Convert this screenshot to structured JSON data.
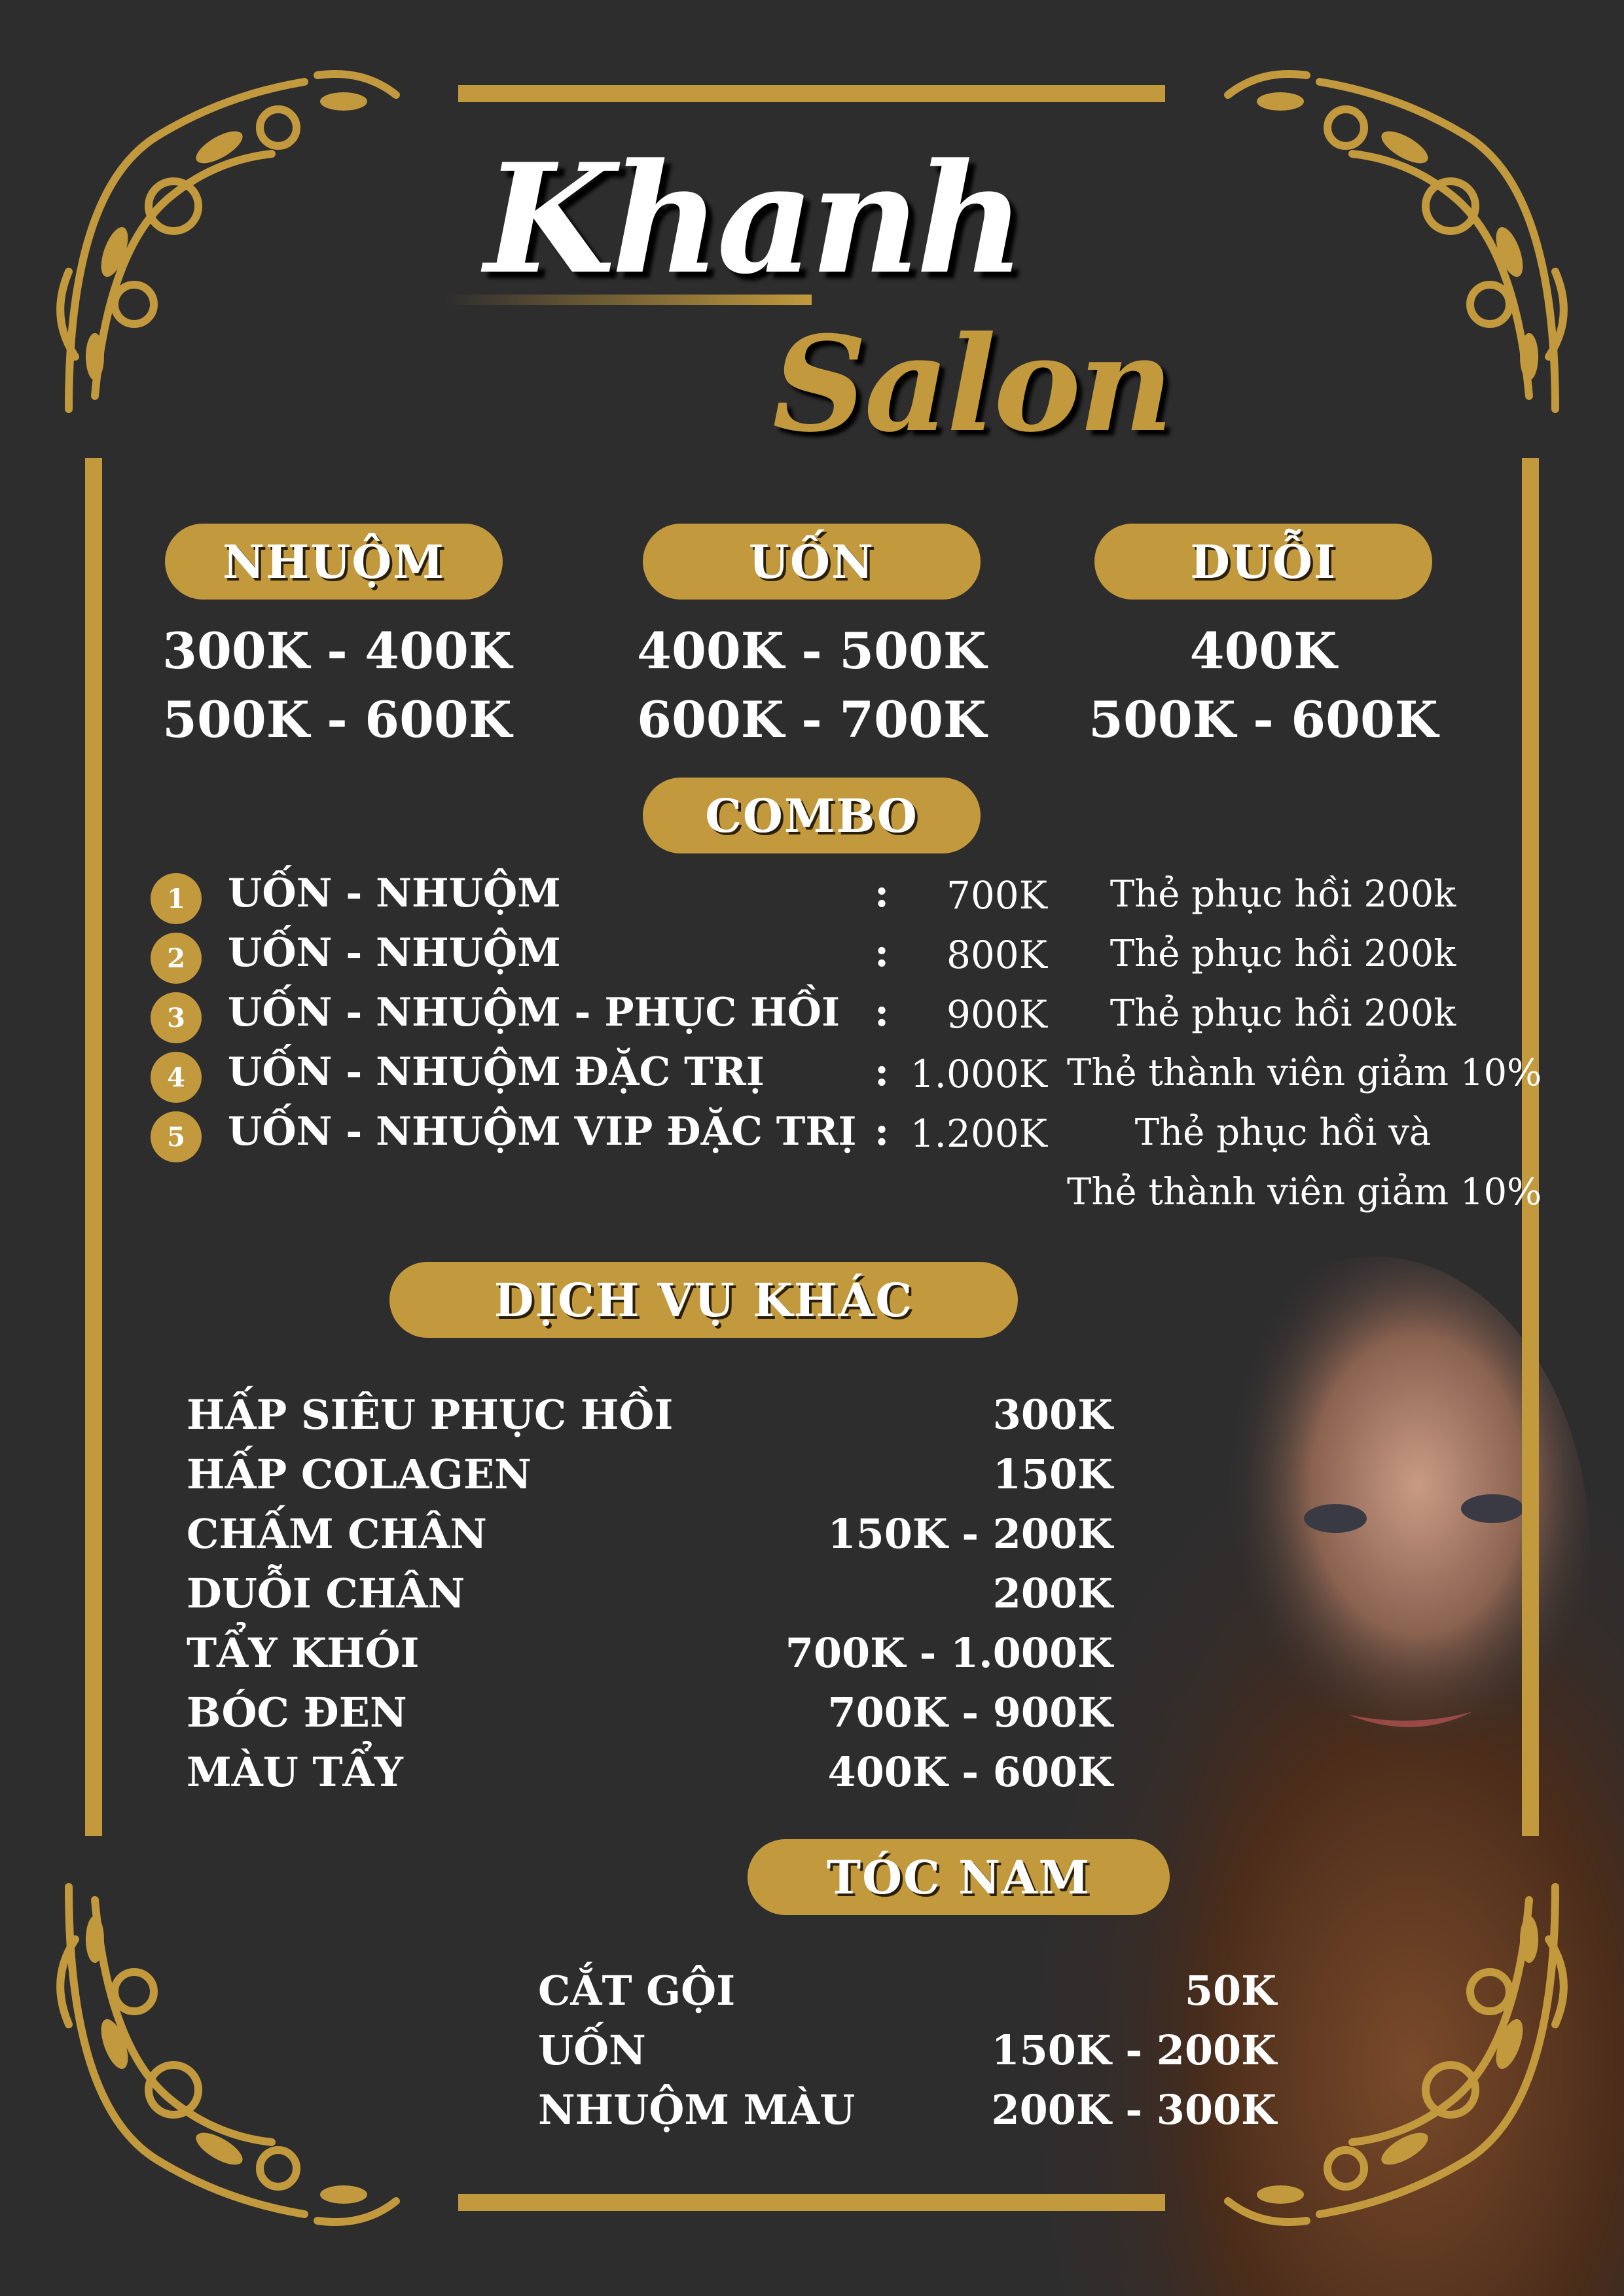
{
  "brand": {
    "line1": "Khanh",
    "line2": "Salon"
  },
  "prices": [
    {
      "title": "NHUỘM",
      "values": [
        "300K - 400K",
        "500K - 600K"
      ]
    },
    {
      "title": "UỐN",
      "values": [
        "400K - 500K",
        "600K - 700K"
      ]
    },
    {
      "title": "DUỖI",
      "values": [
        "400K",
        "500K - 600K"
      ]
    }
  ],
  "combo": {
    "title": "COMBO",
    "items": [
      {
        "num": "1",
        "name": "UỐN - NHUỘM",
        "colon": ":",
        "price": "700K",
        "note": "Thẻ phục hồi 200k"
      },
      {
        "num": "2",
        "name": "UỐN - NHUỘM",
        "colon": ":",
        "price": "800K",
        "note": "Thẻ phục hồi 200k"
      },
      {
        "num": "3",
        "name": "UỐN - NHUỘM - PHỤC HỒI",
        "colon": ":",
        "price": "900K",
        "note": "Thẻ phục hồi 200k"
      },
      {
        "num": "4",
        "name": "UỐN - NHUỘM ĐẶC TRỊ",
        "colon": ":",
        "price": "1.000K",
        "note": "Thẻ thành viên giảm 10%"
      },
      {
        "num": "5",
        "name": "UỐN - NHUỘM VIP ĐẶC TRỊ",
        "colon": ":",
        "price": "1.200K",
        "note": "Thẻ phục hồi và",
        "note2": "Thẻ thành viên giảm 10%"
      }
    ]
  },
  "other": {
    "title": "DỊCH VỤ KHÁC",
    "items": [
      {
        "name": "HẤP SIÊU PHỤC HỒI",
        "price": "300K"
      },
      {
        "name": "HẤP COLAGEN",
        "price": "150K"
      },
      {
        "name": "CHẤM CHÂN",
        "price": "150K - 200K"
      },
      {
        "name": "DUỖI CHÂN",
        "price": "200K"
      },
      {
        "name": "TẨY KHÓI",
        "price": "700K - 1.000K"
      },
      {
        "name": "BÓC ĐEN",
        "price": "700K - 900K"
      },
      {
        "name": "MÀU TẨY",
        "price": "400K - 600K"
      }
    ]
  },
  "men": {
    "title": "TÓC NAM",
    "items": [
      {
        "name": "CẮT GỘI",
        "price": "50K"
      },
      {
        "name": "UỐN",
        "price": "150K - 200K"
      },
      {
        "name": "NHUỘM MÀU",
        "price": "200K - 300K"
      }
    ]
  },
  "colors": {
    "gold": "#c29a3d",
    "background": "#2e2d2e",
    "text": "#ffffff"
  },
  "icons": [
    "floral-corner-ornament",
    "woman-portrait-photo"
  ]
}
